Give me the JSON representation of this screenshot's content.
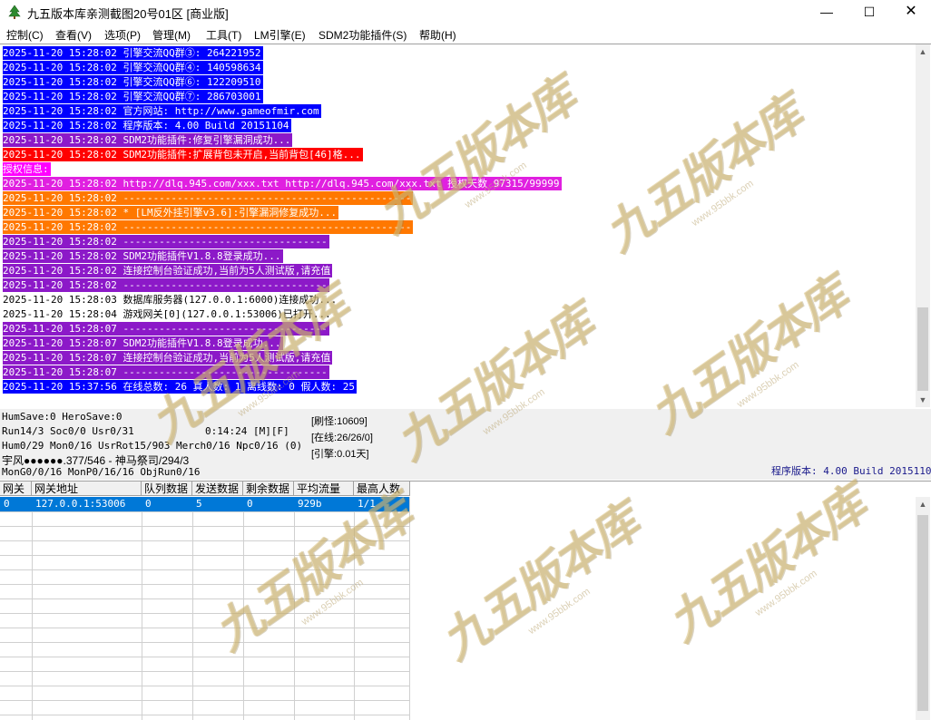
{
  "window": {
    "title": "九五版本库亲测截图20号01区 [商业版]",
    "minimize": "—",
    "maximize": "☐",
    "close": "✕",
    "icon": "app-tree-icon"
  },
  "menu": [
    "控制(C)",
    "查看(V)",
    "选项(P)",
    "管理(M)",
    "工具(T)",
    "LM引擎(E)",
    "SDM2功能插件(S)",
    "帮助(H)"
  ],
  "log": [
    {
      "text": "2025-11-20 15:28:02 引擎交流QQ群③: 264221952",
      "bg": "#0000ff",
      "fg": "#ffffff"
    },
    {
      "text": "2025-11-20 15:28:02 引擎交流QQ群④: 140598634",
      "bg": "#0000ff",
      "fg": "#ffffff"
    },
    {
      "text": "2025-11-20 15:28:02 引擎交流QQ群⑥: 122209510",
      "bg": "#0000ff",
      "fg": "#ffffff"
    },
    {
      "text": "2025-11-20 15:28:02 引擎交流QQ群⑦: 286703001",
      "bg": "#0000ff",
      "fg": "#ffffff"
    },
    {
      "text": "2025-11-20 15:28:02 官方网站: http://www.gameofmir.com",
      "bg": "#0000ff",
      "fg": "#ffffff"
    },
    {
      "text": "2025-11-20 15:28:02 程序版本: 4.00 Build 20151104",
      "bg": "#0000ff",
      "fg": "#ffffff"
    },
    {
      "text": "2025-11-20 15:28:02 SDM2功能插件:修复引擎漏洞成功...",
      "bg": "#8c19c8",
      "fg": "#ffffff"
    },
    {
      "text": "2025-11-20 15:28:02 SDM2功能插件:扩展背包未开启,当前背包[46]格...",
      "bg": "#ff0000",
      "fg": "#ffffff"
    },
    {
      "text": "授权信息:",
      "bg": "#ff00ff",
      "fg": "#ffffff"
    },
    {
      "text": "2025-11-20 15:28:02 http://dlq.945.com/xxx.txt http://dlq.945.com/xxx.txt 授权天数 97315/99999",
      "bg": "#e020e0",
      "fg": "#ffffff"
    },
    {
      "text": "2025-11-20 15:28:02 ------------------------------------------------",
      "bg": "#ff7800",
      "fg": "#ffffff"
    },
    {
      "text": "2025-11-20 15:28:02 * [LM反外挂引擎v3.6]:引擎漏洞修复成功...",
      "bg": "#ff7800",
      "fg": "#ffffff"
    },
    {
      "text": "2025-11-20 15:28:02 ------------------------------------------------",
      "bg": "#ff7800",
      "fg": "#ffffff"
    },
    {
      "text": "2025-11-20 15:28:02 ----------------------------------",
      "bg": "#8c19c8",
      "fg": "#ffffff"
    },
    {
      "text": "2025-11-20 15:28:02 SDM2功能插件V1.8.8登录成功...",
      "bg": "#8c19c8",
      "fg": "#ffffff"
    },
    {
      "text": "2025-11-20 15:28:02 连接控制台验证成功,当前为5人测试版,请充值",
      "bg": "#8c19c8",
      "fg": "#ffffff"
    },
    {
      "text": "2025-11-20 15:28:02 ----------------------------------",
      "bg": "#8c19c8",
      "fg": "#ffffff"
    },
    {
      "text": "2025-11-20 15:28:03 数据库服务器(127.0.0.1:6000)连接成功...",
      "bg": "transparent",
      "fg": "#000000"
    },
    {
      "text": "2025-11-20 15:28:04 游戏网关[0](127.0.0.1:53006)已打开...",
      "bg": "transparent",
      "fg": "#000000"
    },
    {
      "text": "2025-11-20 15:28:07 ----------------------------------",
      "bg": "#8c19c8",
      "fg": "#ffffff"
    },
    {
      "text": "2025-11-20 15:28:07 SDM2功能插件V1.8.8登录成功...",
      "bg": "#8c19c8",
      "fg": "#ffffff"
    },
    {
      "text": "2025-11-20 15:28:07 连接控制台验证成功,当前为5人测试版,请充值",
      "bg": "#8c19c8",
      "fg": "#ffffff"
    },
    {
      "text": "2025-11-20 15:28:07 ----------------------------------",
      "bg": "#8c19c8",
      "fg": "#ffffff"
    },
    {
      "text": "2025-11-20 15:37:56 在线总数: 26 真人数: 1 离线数: 0 假人数: 25",
      "bg": "#0000ff",
      "fg": "#ffffff"
    }
  ],
  "status": {
    "line1": "HumSave:0 HeroSave:0",
    "line2": "Run14/3 Soc0/0 Usr0/31",
    "time": "0:14:24 [M][F]",
    "line3": "Hum0/29 Mon0/16 UsrRot15/903 Merch0/16 Npc0/16 (0)",
    "line4": "宇风●●●●●●.377/546 - 神马祭司/294/3",
    "line5": "MonG0/0/16 MonP0/16/16 ObjRun0/16",
    "refresh": "[刷怪:10609]",
    "online": "[在线:26/26/0]",
    "engine": "[引擎:0.01天]",
    "version": "程序版本: 4.00 Build 20151104"
  },
  "table": {
    "headers": [
      "网关",
      "网关地址",
      "队列数据",
      "发送数据",
      "剩余数据",
      "平均流量",
      "最高人数"
    ],
    "rows": [
      [
        "0",
        "127.0.0.1:53006",
        "0",
        "5",
        "0",
        "929b",
        "1/1"
      ]
    ]
  },
  "watermark": {
    "big": "九五版本库",
    "small": "www.95bbk.com"
  }
}
